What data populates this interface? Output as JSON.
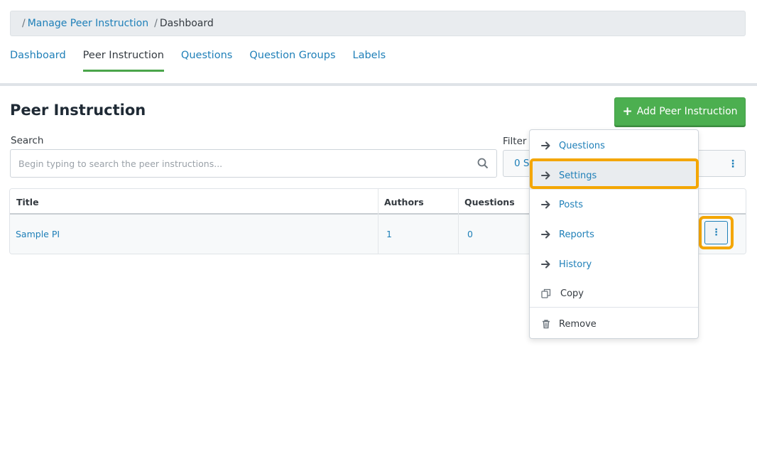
{
  "breadcrumb": {
    "link": "Manage Peer Instruction",
    "current": "Dashboard",
    "sep": "/"
  },
  "tabs": [
    {
      "label": "Dashboard"
    },
    {
      "label": "Peer Instruction"
    },
    {
      "label": "Questions"
    },
    {
      "label": "Question Groups"
    },
    {
      "label": "Labels"
    }
  ],
  "page": {
    "title": "Peer Instruction",
    "add_button": "Add Peer Instruction"
  },
  "search": {
    "label": "Search",
    "placeholder": "Begin typing to search the peer instructions..."
  },
  "filter": {
    "label": "Filter l",
    "value": "0 S"
  },
  "table": {
    "headers": [
      "Title",
      "Authors",
      "Questions"
    ],
    "rows": [
      {
        "title": "Sample PI",
        "authors": "1",
        "questions": "0"
      }
    ]
  },
  "menu": {
    "items": [
      {
        "label": "Questions",
        "icon": "arrow-right-icon"
      },
      {
        "label": "Settings",
        "icon": "arrow-right-icon"
      },
      {
        "label": "Posts",
        "icon": "arrow-right-icon"
      },
      {
        "label": "Reports",
        "icon": "arrow-right-icon"
      },
      {
        "label": "History",
        "icon": "arrow-right-icon"
      },
      {
        "label": "Copy",
        "icon": "copy-icon"
      },
      {
        "label": "Remove",
        "icon": "trash-icon"
      }
    ]
  },
  "colors": {
    "accent": "#1e7fb8",
    "green": "#4caf50",
    "highlight": "#f4a600"
  }
}
